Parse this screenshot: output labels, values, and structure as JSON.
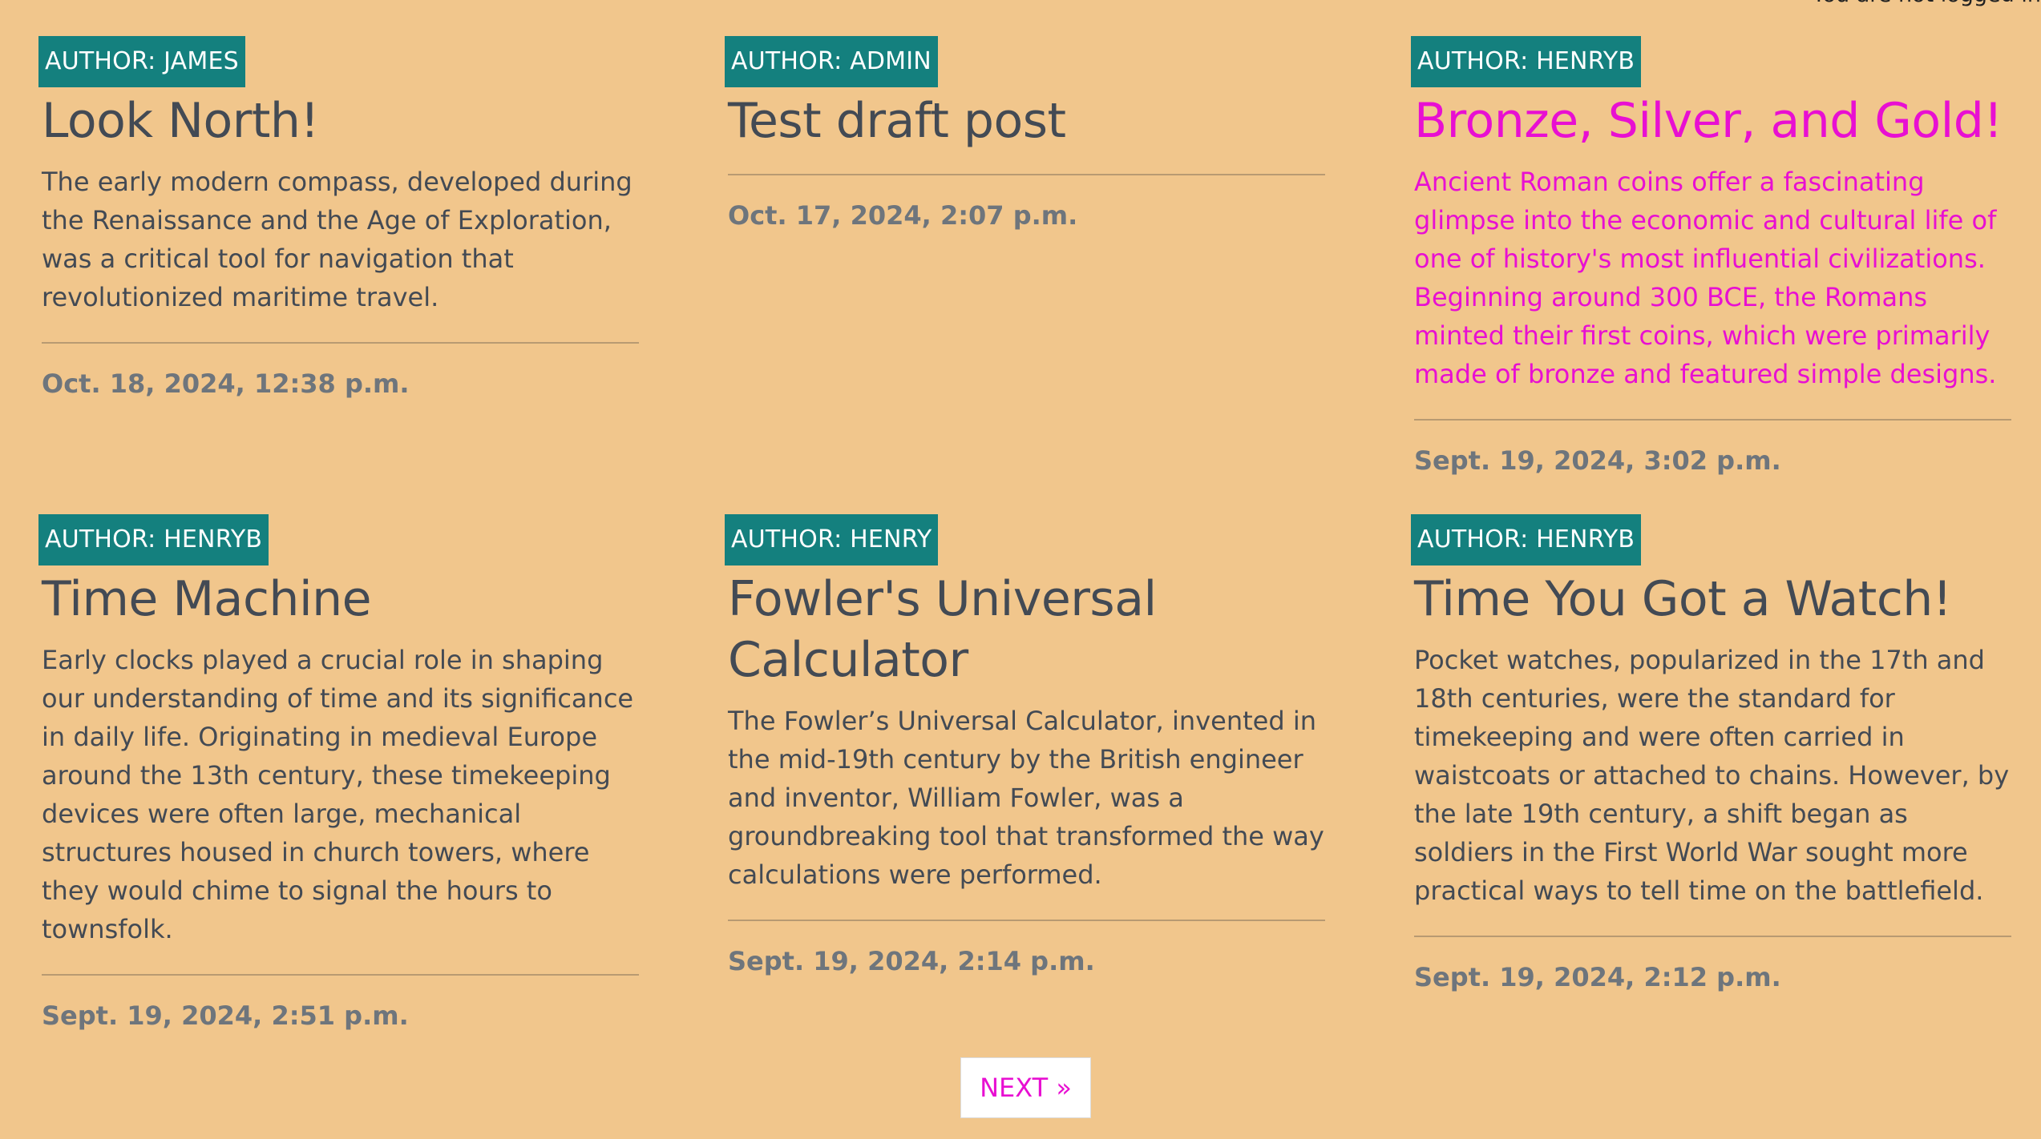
{
  "header": {
    "login_status": "You are not logged in"
  },
  "posts": [
    {
      "author": "AUTHOR: JAMES",
      "title": "Look North!",
      "excerpt": "The early modern compass, developed during the Renaissance and the Age of Exploration, was a critical tool for navigation that revolutionized maritime travel.",
      "date": "Oct. 18, 2024, 12:38 p.m."
    },
    {
      "author": "AUTHOR: ADMIN",
      "title": "Test draft post",
      "excerpt": "",
      "date": "Oct. 17, 2024, 2:07 p.m."
    },
    {
      "author": "AUTHOR: HENRYB",
      "title": "Bronze, Silver, and Gold!",
      "excerpt": "Ancient Roman coins offer a fascinating glimpse into the economic and cultural life of one of history's most influential civilizations. Beginning around 300 BCE, the Romans minted their first coins, which were primarily made of bronze and featured simple designs.",
      "date": "Sept. 19, 2024, 3:02 p.m."
    },
    {
      "author": "AUTHOR: HENRYB",
      "title": "Time Machine",
      "excerpt": "Early clocks played a crucial role in shaping our understanding of time and its significance in daily life. Originating in medieval Europe around the 13th century, these timekeeping devices were often large, mechanical structures housed in church towers, where they would chime to signal the hours to townsfolk.",
      "date": "Sept. 19, 2024, 2:51 p.m."
    },
    {
      "author": "AUTHOR: HENRY",
      "title": "Fowler's Universal Calculator",
      "excerpt": "The Fowler’s Universal Calculator, invented in the mid-19th century by the British engineer and inventor, William Fowler, was a groundbreaking tool that transformed the way calculations were performed.",
      "date": "Sept. 19, 2024, 2:14 p.m."
    },
    {
      "author": "AUTHOR: HENRYB",
      "title": "Time You Got a Watch!",
      "excerpt": "Pocket watches, popularized in the 17th and 18th centuries, were the standard for timekeeping and were often carried in waistcoats or attached to chains. However, by the late 19th century, a shift began as soldiers in the First World War sought more practical ways to tell time on the battlefield.",
      "date": "Sept. 19, 2024, 2:12 p.m."
    }
  ],
  "pagination": {
    "next_label": "NEXT »"
  },
  "colors": {
    "background": "#f1c68c",
    "badge": "#14807e",
    "text": "#434a54",
    "date": "#6e757c",
    "highlight": "#e80fd2"
  }
}
